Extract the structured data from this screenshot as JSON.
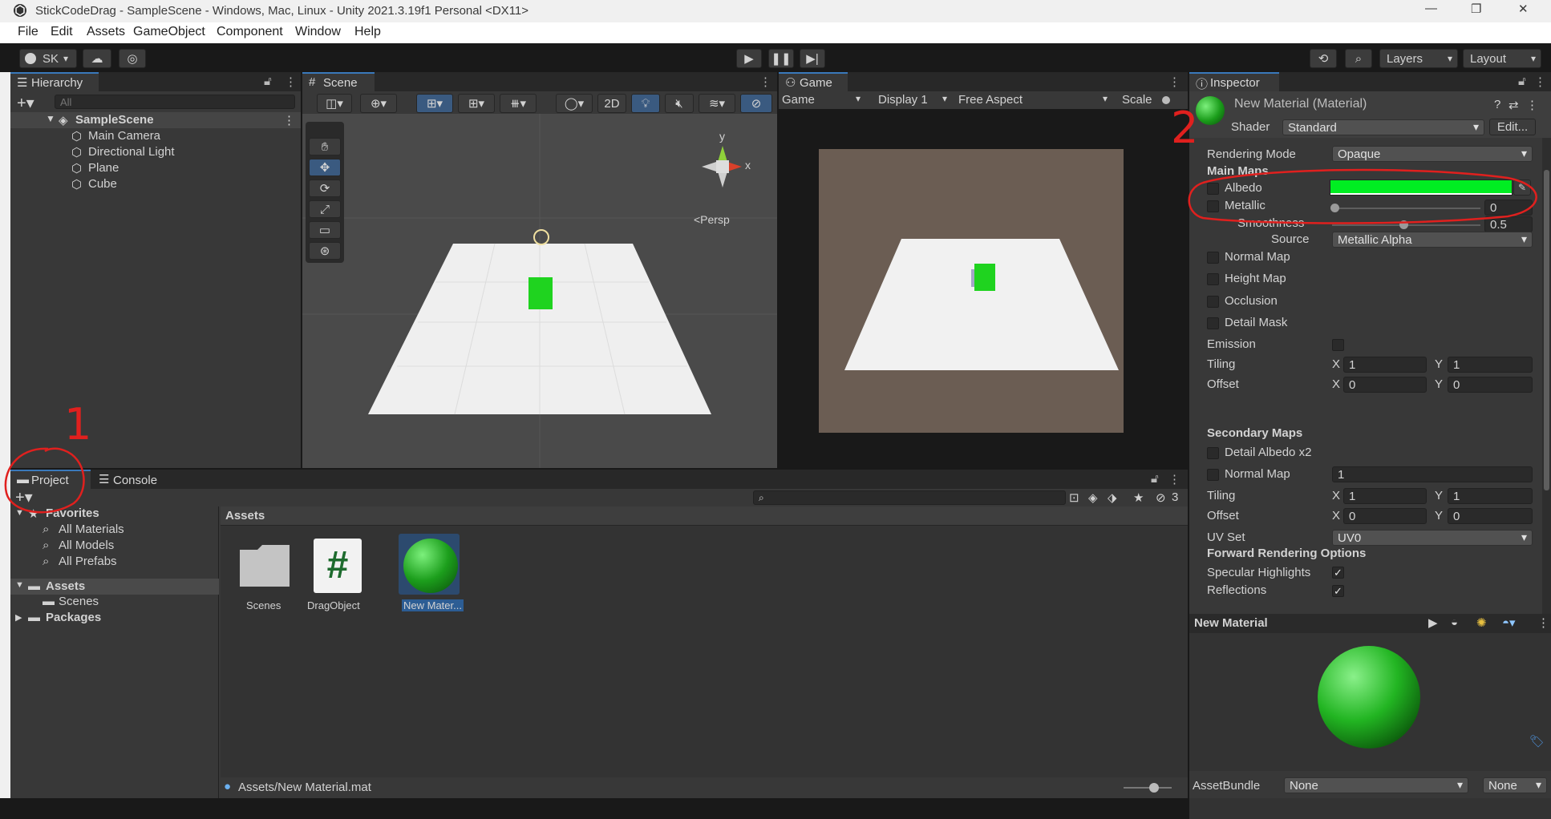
{
  "window": {
    "title": "StickCodeDrag - SampleScene - Windows, Mac, Linux - Unity 2021.3.19f1 Personal <DX11>",
    "min": "—",
    "max": "❐",
    "close": "✕"
  },
  "menu": [
    "File",
    "Edit",
    "Assets",
    "GameObject",
    "Component",
    "Window",
    "Help"
  ],
  "toolbar": {
    "account": "SK",
    "layers": "Layers",
    "layout": "Layout"
  },
  "hierarchy": {
    "tab": "Hierarchy",
    "search_placeholder": "All",
    "scene": "SampleScene",
    "items": [
      "Main Camera",
      "Directional Light",
      "Plane",
      "Cube"
    ]
  },
  "scene": {
    "tab": "Scene",
    "mode2d": "2D",
    "gizmo_y": "y",
    "gizmo_x": "x",
    "persp": "<Persp"
  },
  "game": {
    "tab": "Game",
    "mode": "Game",
    "display": "Display 1",
    "aspect": "Free Aspect",
    "scale": "Scale"
  },
  "inspector": {
    "tab": "Inspector",
    "title": "New Material (Material)",
    "shader_label": "Shader",
    "shader": "Standard",
    "edit": "Edit...",
    "rendering_mode_label": "Rendering Mode",
    "rendering_mode": "Opaque",
    "main_maps": "Main Maps",
    "albedo": "Albedo",
    "albedo_color": "#00ee22",
    "metallic": "Metallic",
    "metallic_value": "0",
    "smoothness": "Smoothness",
    "smoothness_value": "0.5",
    "source": "Source",
    "source_value": "Metallic Alpha",
    "normal_map": "Normal Map",
    "height_map": "Height Map",
    "occlusion": "Occlusion",
    "detail_mask": "Detail Mask",
    "emission": "Emission",
    "tiling": "Tiling",
    "offset": "Offset",
    "x": "X",
    "y": "Y",
    "tiling_x": "1",
    "tiling_y": "1",
    "offset_x": "0",
    "offset_y": "0",
    "secondary_maps": "Secondary Maps",
    "detail_albedo": "Detail Albedo x2",
    "sec_normal": "Normal Map",
    "sec_normal_value": "1",
    "sec_tiling_x": "1",
    "sec_tiling_y": "1",
    "sec_offset_x": "0",
    "sec_offset_y": "0",
    "uv_set": "UV Set",
    "uv_set_value": "UV0",
    "forward": "Forward Rendering Options",
    "specular": "Specular Highlights",
    "reflections": "Reflections",
    "preview_title": "New Material",
    "assetbundle": "AssetBundle",
    "assetbundle_value": "None",
    "variant_value": "None"
  },
  "project": {
    "tab": "Project",
    "console": "Console",
    "favorites": "Favorites",
    "fav_items": [
      "All Materials",
      "All Models",
      "All Prefabs"
    ],
    "assets": "Assets",
    "scenes": "Scenes",
    "packages": "Packages",
    "breadcrumb": "Assets",
    "files": [
      "Scenes",
      "DragObject",
      "New Mater..."
    ],
    "status_path": "Assets/New Material.mat",
    "hidden_count": "3"
  },
  "annotations": {
    "one": "1",
    "two": "2"
  }
}
